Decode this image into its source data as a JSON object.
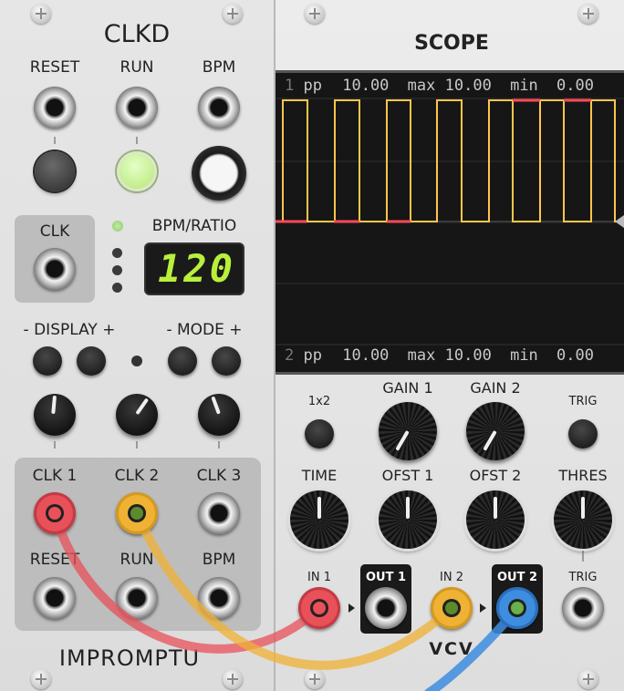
{
  "clkd": {
    "title": "CLKD",
    "top_labels": [
      "RESET",
      "RUN",
      "BPM"
    ],
    "clk_label": "CLK",
    "bpm_ratio_label": "BPM/RATIO",
    "display_value": "120",
    "display_label": "- DISPLAY +",
    "mode_label": "- MODE +",
    "out_labels": [
      "CLK 1",
      "CLK 2",
      "CLK 3"
    ],
    "in_labels": [
      "RESET",
      "RUN",
      "BPM"
    ],
    "brand": "IMPROMPTU"
  },
  "scope": {
    "title": "SCOPE",
    "readout1": {
      "ch": "1",
      "pp": "pp",
      "pp_val": "10.00",
      "max": "max",
      "max_val": "10.00",
      "min": "min",
      "min_val": "0.00"
    },
    "readout2": {
      "ch": "2",
      "pp": "pp",
      "pp_val": "10.00",
      "max": "max",
      "max_val": "10.00",
      "min": "min",
      "min_val": "0.00"
    },
    "mode_label": "1x2",
    "gain1": "GAIN 1",
    "gain2": "GAIN 2",
    "trig_btn_label": "TRIG",
    "time": "TIME",
    "ofst1": "OFST 1",
    "ofst2": "OFST 2",
    "thres": "THRES",
    "in1": "IN 1",
    "out1": "OUT 1",
    "in2": "IN 2",
    "out2": "OUT 2",
    "trig_in": "TRIG",
    "brand": "VCV"
  },
  "colors": {
    "cable_red": "#e8505a",
    "cable_yellow": "#f0b234",
    "cable_blue": "#3d8de0",
    "trace_yellow": "#ffc64a",
    "trace_red": "#ff4a5a",
    "led_green": "#c4ee8c",
    "lcd_green": "#b8f03c"
  }
}
